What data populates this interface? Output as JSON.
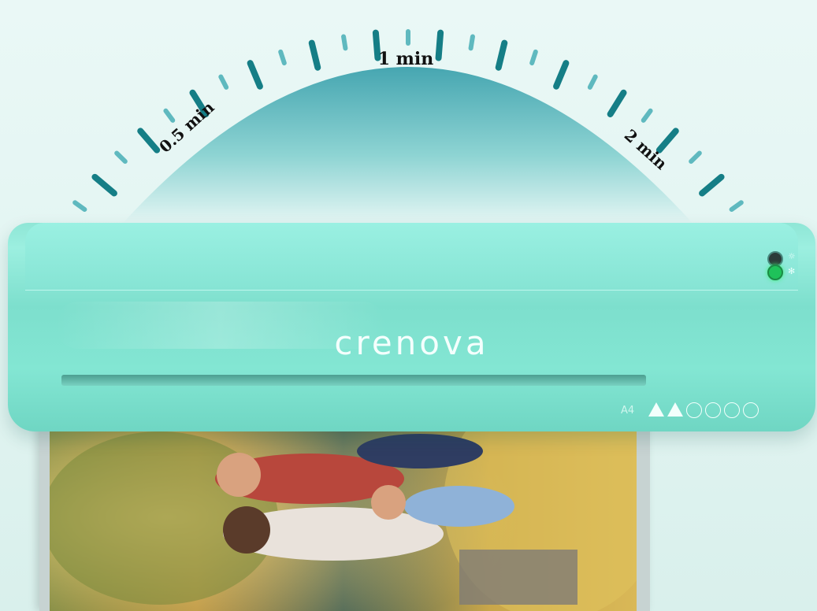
{
  "timer_labels": {
    "half_minute": "0.5 min",
    "one_minute": "1 min",
    "two_minutes": "2 min"
  },
  "machine": {
    "brand": "crenova",
    "size_mark": "A4",
    "indicators": [
      "power-light",
      "ready-light"
    ],
    "body_color": "#86e4d4"
  },
  "colors": {
    "tick": "#157e86",
    "tick_light": "#5fb9bf",
    "dome_top": "#4aa9b3",
    "dome_bottom": "#eaf8f6"
  },
  "photo": {
    "subject": "family with a dog sitting in a sunny field"
  }
}
